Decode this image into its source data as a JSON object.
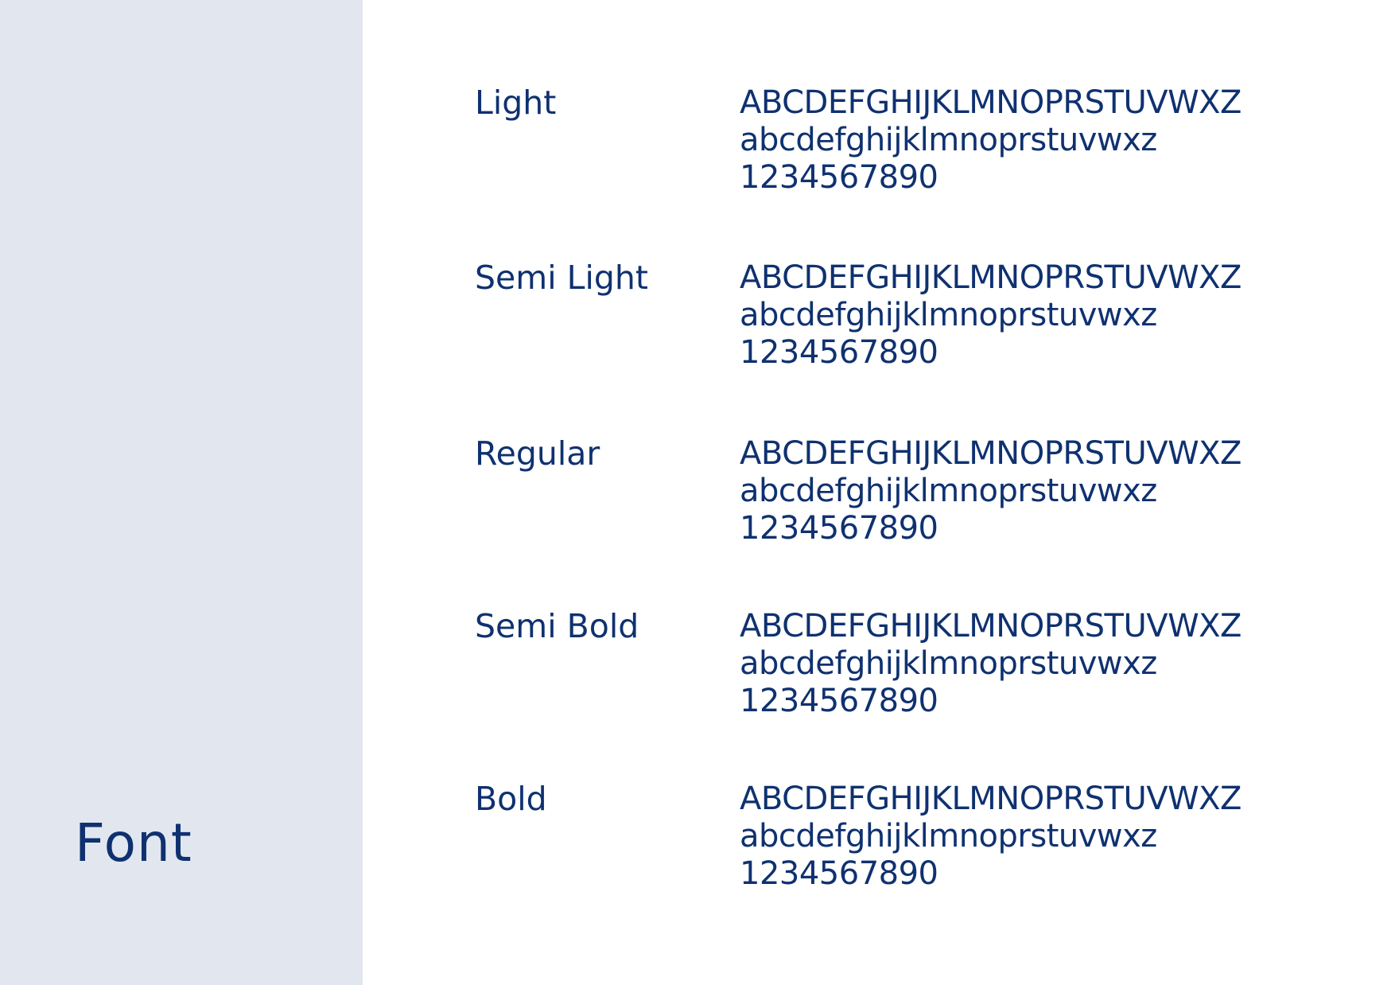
{
  "colors": {
    "sidebar_bg": "#e2e7ef",
    "page_bg": "#ffffff",
    "text": "#0f3170"
  },
  "sidebar": {
    "title": "Font"
  },
  "weights": [
    {
      "label": "Light",
      "uppercase": "ABCDEFGHIJKLMNOPRSTUVWXZ",
      "lowercase": "abcdefghijklmnoprstuvwxz",
      "digits": "1234567890"
    },
    {
      "label": "Semi Light",
      "uppercase": "ABCDEFGHIJKLMNOPRSTUVWXZ",
      "lowercase": "abcdefghijklmnoprstuvwxz",
      "digits": "1234567890"
    },
    {
      "label": "Regular",
      "uppercase": "ABCDEFGHIJKLMNOPRSTUVWXZ",
      "lowercase": "abcdefghijklmnoprstuvwxz",
      "digits": "1234567890"
    },
    {
      "label": "Semi Bold",
      "uppercase": "ABCDEFGHIJKLMNOPRSTUVWXZ",
      "lowercase": "abcdefghijklmnoprstuvwxz",
      "digits": "1234567890"
    },
    {
      "label": "Bold",
      "uppercase": "ABCDEFGHIJKLMNOPRSTUVWXZ",
      "lowercase": "abcdefghijklmnoprstuvwxz",
      "digits": "1234567890"
    }
  ]
}
